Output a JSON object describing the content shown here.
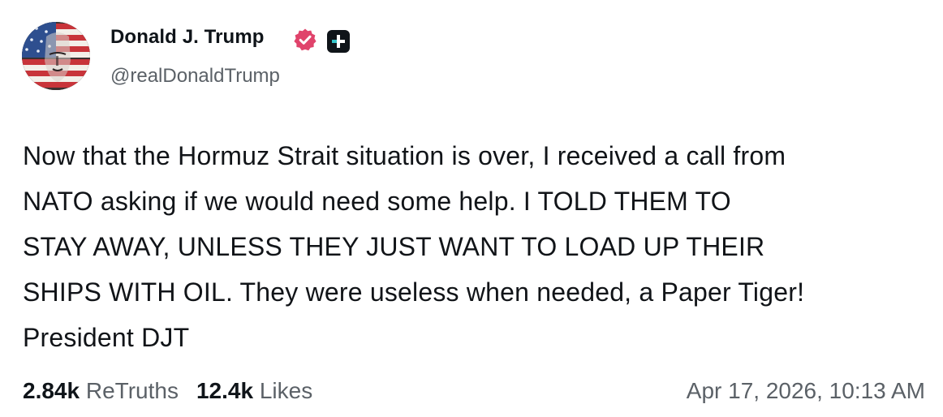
{
  "author": {
    "display_name": "Donald J. Trump",
    "handle": "@realDonaldTrump",
    "avatar_icon": "flag-portrait-avatar",
    "verified_icon": "verified-badge-icon",
    "verified_color": "#e0436b",
    "plus_icon": "plus-badge-icon"
  },
  "post": {
    "text": "Now that the Hormuz Strait situation is over, I received a call from\nNATO asking if we would need some help. I  TOLD THEM TO\nSTAY AWAY, UNLESS THEY JUST WANT TO LOAD UP THEIR\nSHIPS WITH OIL. They were useless when needed, a Paper Tiger!\nPresident DJT"
  },
  "stats": {
    "retruths_value": "2.84k",
    "retruths_label": "ReTruths",
    "likes_value": "12.4k",
    "likes_label": "Likes"
  },
  "timestamp": "Apr 17, 2026, 10:13 AM"
}
